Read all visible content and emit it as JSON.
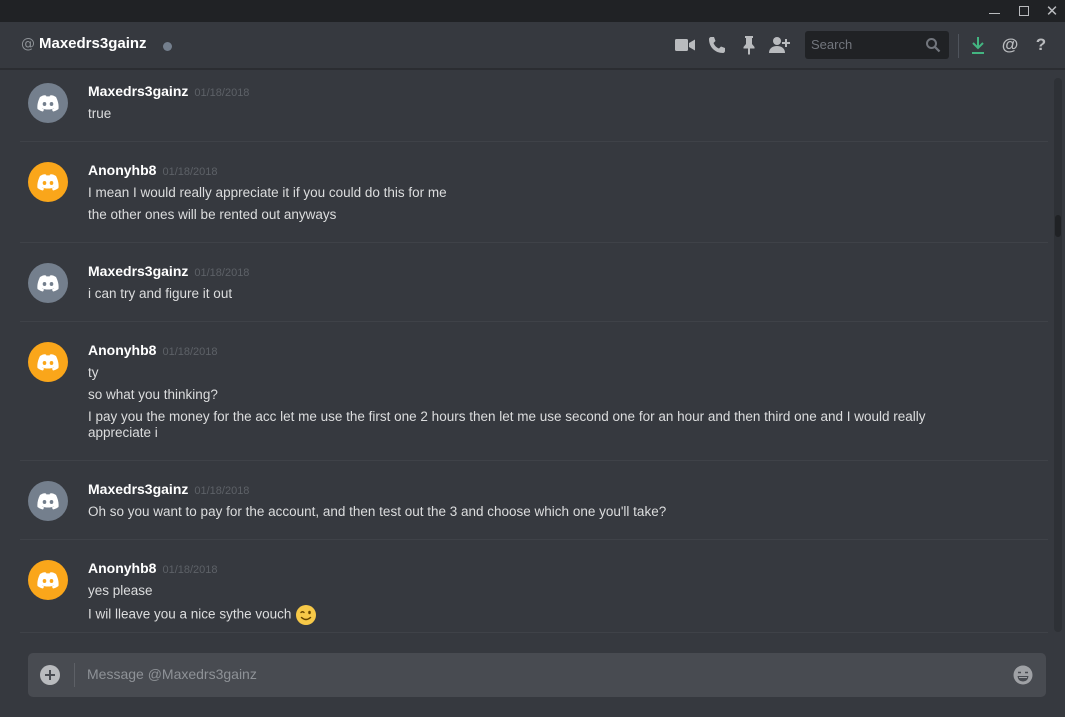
{
  "window": {
    "controls": [
      "minimize",
      "maximize",
      "close"
    ]
  },
  "header": {
    "at_symbol": "@",
    "username": "Maxedrs3gainz",
    "status": "offline",
    "search_placeholder": "Search",
    "icons": [
      "video-call-icon",
      "voice-call-icon",
      "pin-icon",
      "add-friend-icon",
      "search-icon",
      "download-icon",
      "mentions-icon",
      "help-icon"
    ]
  },
  "colors": {
    "background": "#36393f",
    "titlebar": "#202225",
    "default_avatar": "#747f8d",
    "orange_avatar": "#faa61a",
    "download_green": "#43b581"
  },
  "messages": [
    {
      "author": "Maxedrs3gainz",
      "timestamp": "01/18/2018",
      "avatar_color": "#747f8d",
      "lines": [
        "true"
      ]
    },
    {
      "author": "Anonyhb8",
      "timestamp": "01/18/2018",
      "avatar_color": "#faa61a",
      "lines": [
        "I mean I would really appreciate it if you could do this for me",
        "the other ones will be rented out anyways"
      ]
    },
    {
      "author": "Maxedrs3gainz",
      "timestamp": "01/18/2018",
      "avatar_color": "#747f8d",
      "lines": [
        "i can try and figure it out"
      ]
    },
    {
      "author": "Anonyhb8",
      "timestamp": "01/18/2018",
      "avatar_color": "#faa61a",
      "lines": [
        "ty",
        "so what you thinking?",
        "I pay you the money for the acc let me use the first one 2 hours then let me use second one for an hour and then third one and I would really",
        "appreciate i"
      ]
    },
    {
      "author": "Maxedrs3gainz",
      "timestamp": "01/18/2018",
      "avatar_color": "#747f8d",
      "lines": [
        "Oh so you want to pay for the account, and then test out the 3 and choose which one you'll take?"
      ]
    },
    {
      "author": "Anonyhb8",
      "timestamp": "01/18/2018",
      "avatar_color": "#faa61a",
      "lines": [
        "yes please",
        "I wil lleave you a nice sythe vouch"
      ],
      "trailing_emoji": "winking-face-emoji"
    }
  ],
  "composer": {
    "placeholder": "Message @Maxedrs3gainz"
  }
}
